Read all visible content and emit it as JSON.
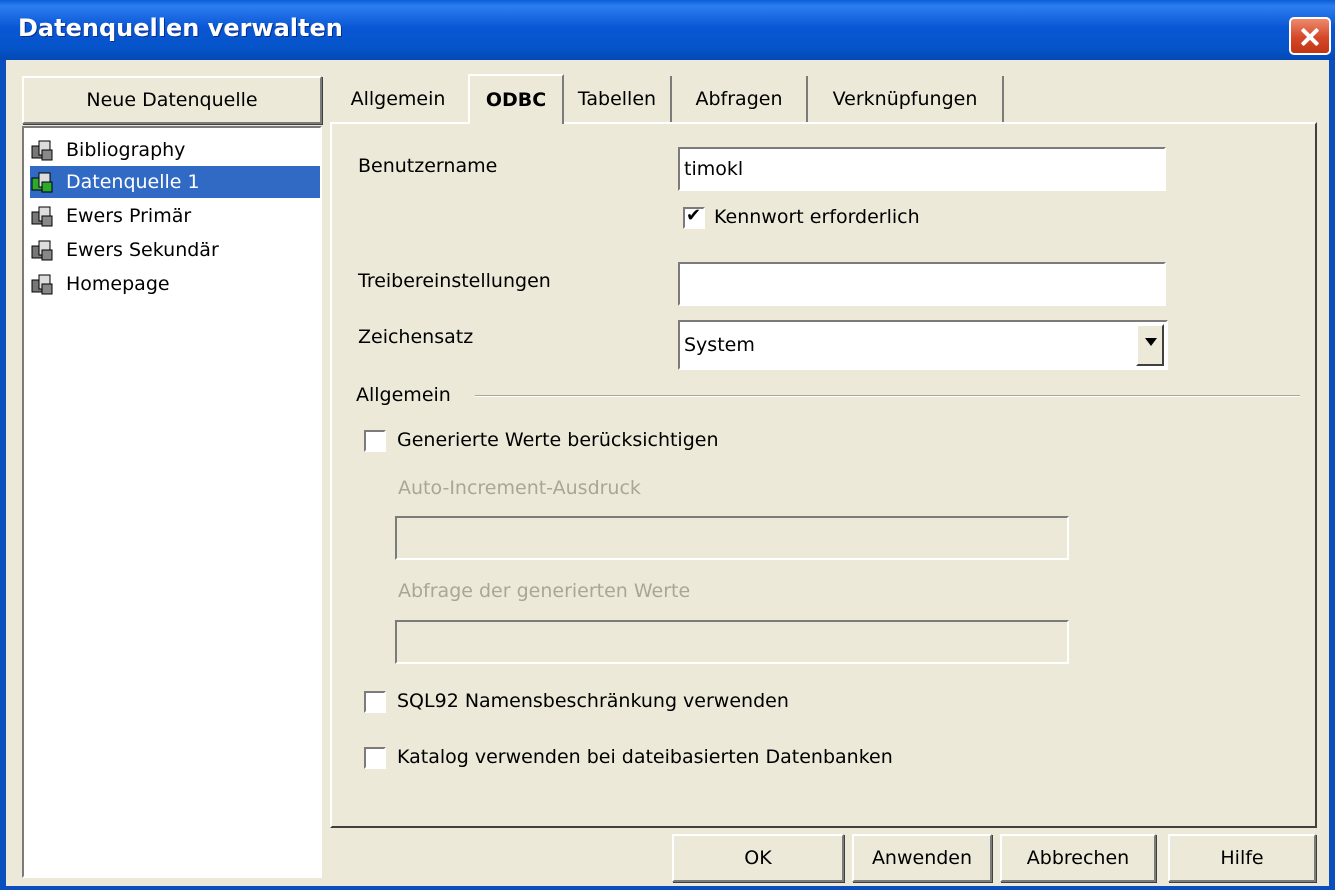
{
  "window": {
    "title": "Datenquellen verwalten"
  },
  "sidebar": {
    "new_button": "Neue Datenquelle",
    "items": [
      {
        "label": "Bibliography",
        "selected": false
      },
      {
        "label": "Datenquelle 1",
        "selected": true
      },
      {
        "label": "Ewers Primär",
        "selected": false
      },
      {
        "label": "Ewers Sekundär",
        "selected": false
      },
      {
        "label": "Homepage",
        "selected": false
      }
    ]
  },
  "tabs": [
    {
      "label": "Allgemein"
    },
    {
      "label": "ODBC",
      "active": true
    },
    {
      "label": "Tabellen"
    },
    {
      "label": "Abfragen"
    },
    {
      "label": "Verknüpfungen"
    }
  ],
  "odbc": {
    "username": {
      "label": "Benutzername",
      "value": "timokl"
    },
    "password_required": {
      "label": "Kennwort erforderlich",
      "checked": true
    },
    "driver_settings": {
      "label": "Treibereinstellungen",
      "value": ""
    },
    "charset": {
      "label": "Zeichensatz",
      "value": "System"
    },
    "group_general": "Allgemein",
    "generated_values": {
      "label": "Generierte Werte berücksichtigen",
      "checked": false
    },
    "auto_increment": {
      "label": "Auto-Increment-Ausdruck",
      "value": ""
    },
    "generated_query": {
      "label": "Abfrage der generierten Werte",
      "value": ""
    },
    "sql92": {
      "label": "SQL92 Namensbeschränkung verwenden",
      "checked": false
    },
    "catalog": {
      "label": "Katalog verwenden bei dateibasierten Datenbanken",
      "checked": false
    }
  },
  "buttons": {
    "ok": "OK",
    "apply": "Anwenden",
    "cancel": "Abbrechen",
    "help": "Hilfe"
  }
}
